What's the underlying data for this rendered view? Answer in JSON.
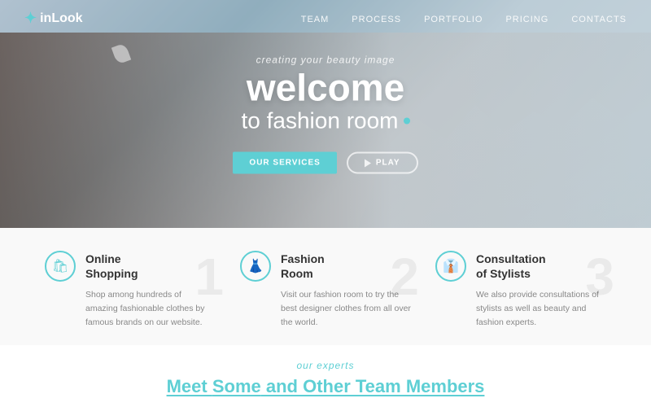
{
  "navbar": {
    "logo_text": "inLook",
    "links": [
      {
        "label": "TEAM",
        "href": "#"
      },
      {
        "label": "PROCESS",
        "href": "#"
      },
      {
        "label": "PORTFOLIO",
        "href": "#"
      },
      {
        "label": "PRICING",
        "href": "#"
      },
      {
        "label": "CONTACTS",
        "href": "#"
      }
    ]
  },
  "hero": {
    "tagline": "creating your beauty image",
    "title_main": "welcome",
    "title_sub": "to fashion room",
    "btn_services": "OUR SERVICES",
    "btn_play": "PLAY"
  },
  "features": [
    {
      "icon": "🛍",
      "title": "Online\nShopping",
      "number": "1",
      "desc": "Shop among hundreds of amazing fashionable clothes by famous brands on our website."
    },
    {
      "icon": "👗",
      "title": "Fashion\nRoom",
      "number": "2",
      "desc": "Visit our fashion room to try the best designer clothes from all over the world."
    },
    {
      "icon": "👔",
      "title": "Consultation\nof Stylists",
      "number": "3",
      "desc": "We also provide consultations of stylists as well as beauty and fashion experts."
    }
  ],
  "experts": {
    "subtitle": "our experts",
    "title_prefix": "Meet ",
    "title_accent": "Some",
    "title_suffix": " and Other Team Members"
  }
}
